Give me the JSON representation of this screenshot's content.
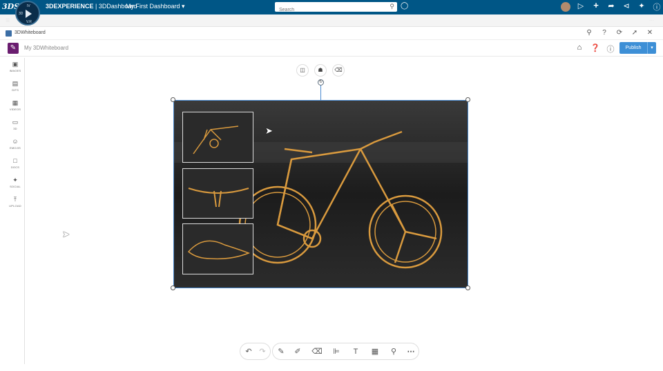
{
  "topbar": {
    "brand": "3DEXPERIENCE",
    "app": "3DDashboard",
    "separator": " | ",
    "dashboard": "My First Dashboard",
    "search_placeholder": "Search",
    "compass_quadrants": [
      "3D",
      "IV",
      "V.R"
    ]
  },
  "widget": {
    "title": "3DWhiteboard"
  },
  "app_header": {
    "board_name": "My 3DWhiteboard",
    "publish_label": "Publish"
  },
  "sidebar": {
    "items": [
      {
        "label": "IMAGES",
        "icon": "image-icon"
      },
      {
        "label": "GIFS",
        "icon": "gif-icon"
      },
      {
        "label": "VIDEOS",
        "icon": "video-icon"
      },
      {
        "label": "3D",
        "icon": "cube-icon"
      },
      {
        "label": "EMOJIS",
        "icon": "emoji-icon"
      },
      {
        "label": "DOCS",
        "icon": "document-icon"
      },
      {
        "label": "SOCIAL",
        "icon": "social-icon"
      },
      {
        "label": "UPLOAD",
        "icon": "upload-icon"
      }
    ]
  },
  "colors": {
    "topbar": "#005686",
    "accent": "#3d8fd6",
    "app_logo": "#6a1d6f",
    "bike_lines": "#d99a3e"
  }
}
